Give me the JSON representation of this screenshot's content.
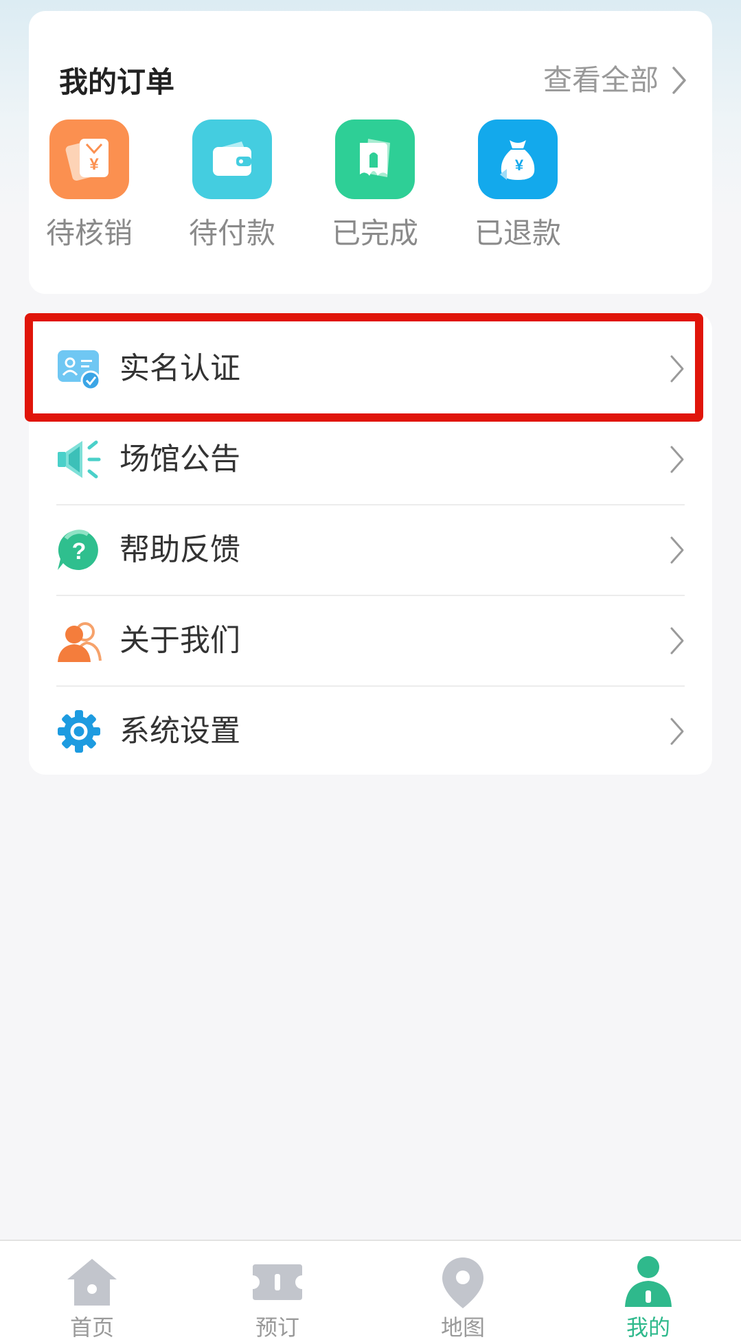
{
  "orders": {
    "title": "我的订单",
    "view_all": "查看全部",
    "items": [
      {
        "label": "待核销",
        "icon": "voucher-icon",
        "color": "#fb9050"
      },
      {
        "label": "待付款",
        "icon": "wallet-icon",
        "color": "#44cde0"
      },
      {
        "label": "已完成",
        "icon": "ticket-complete-icon",
        "color": "#2ecf96"
      },
      {
        "label": "已退款",
        "icon": "refund-bag-icon",
        "color": "#13a9ec"
      }
    ]
  },
  "menu": {
    "items": [
      {
        "label": "实名认证",
        "icon": "id-card-verified-icon",
        "highlighted": true
      },
      {
        "label": "场馆公告",
        "icon": "megaphone-icon"
      },
      {
        "label": "帮助反馈",
        "icon": "help-bubble-icon"
      },
      {
        "label": "关于我们",
        "icon": "people-icon"
      },
      {
        "label": "系统设置",
        "icon": "gear-icon"
      }
    ]
  },
  "tabbar": {
    "items": [
      {
        "label": "首页",
        "icon": "home-icon"
      },
      {
        "label": "预订",
        "icon": "ticket-icon"
      },
      {
        "label": "地图",
        "icon": "map-pin-icon"
      },
      {
        "label": "我的",
        "icon": "user-icon",
        "active": true
      }
    ],
    "active_color": "#2fb98c",
    "inactive_color": "#c2c5cc"
  },
  "colors": {
    "highlight_border": "#e0150a",
    "page_background": "#f6f6f8"
  }
}
